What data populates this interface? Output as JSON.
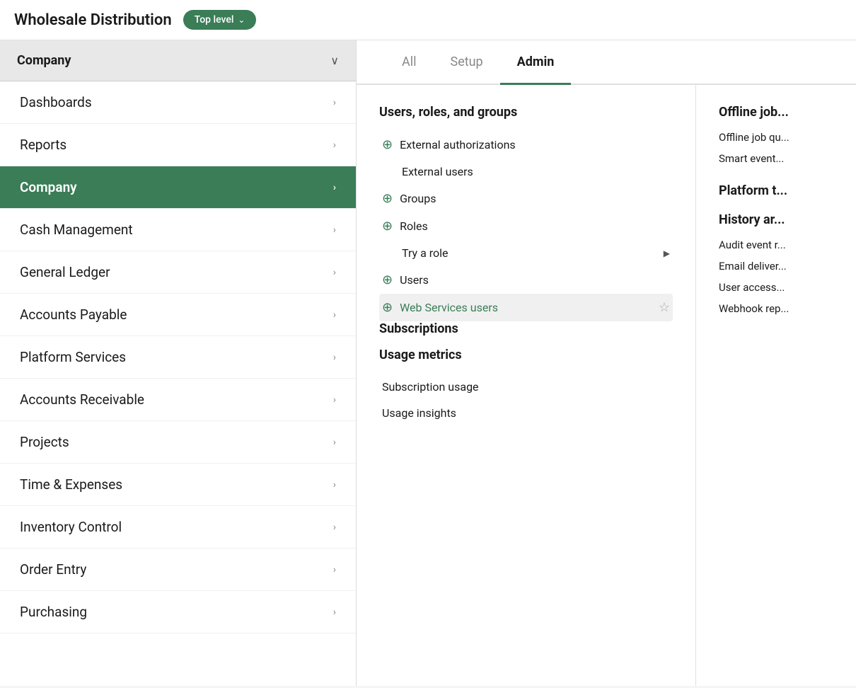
{
  "header": {
    "title": "Wholesale Distribution",
    "badge_label": "Top level",
    "badge_chevron": "⌄"
  },
  "sidebar": {
    "header_label": "Company",
    "header_chevron": "∨",
    "items": [
      {
        "id": "dashboards",
        "label": "Dashboards",
        "active": false
      },
      {
        "id": "reports",
        "label": "Reports",
        "active": false
      },
      {
        "id": "company",
        "label": "Company",
        "active": true
      },
      {
        "id": "cash-management",
        "label": "Cash Management",
        "active": false
      },
      {
        "id": "general-ledger",
        "label": "General Ledger",
        "active": false
      },
      {
        "id": "accounts-payable",
        "label": "Accounts Payable",
        "active": false
      },
      {
        "id": "platform-services",
        "label": "Platform Services",
        "active": false
      },
      {
        "id": "accounts-receivable",
        "label": "Accounts Receivable",
        "active": false
      },
      {
        "id": "projects",
        "label": "Projects",
        "active": false
      },
      {
        "id": "time-expenses",
        "label": "Time & Expenses",
        "active": false
      },
      {
        "id": "inventory-control",
        "label": "Inventory Control",
        "active": false
      },
      {
        "id": "order-entry",
        "label": "Order Entry",
        "active": false
      },
      {
        "id": "purchasing",
        "label": "Purchasing",
        "active": false
      }
    ]
  },
  "tabs": [
    {
      "id": "all",
      "label": "All",
      "active": false
    },
    {
      "id": "setup",
      "label": "Setup",
      "active": false
    },
    {
      "id": "admin",
      "label": "Admin",
      "active": true
    }
  ],
  "menu": {
    "sections": [
      {
        "id": "users-roles-groups",
        "title": "Users, roles, and groups",
        "items": [
          {
            "id": "external-auth",
            "label": "External authorizations",
            "has_plus": true,
            "highlighted": false,
            "green": false,
            "has_arrow": false,
            "has_star": false,
            "indented": false
          },
          {
            "id": "external-users",
            "label": "External users",
            "has_plus": false,
            "highlighted": false,
            "green": false,
            "has_arrow": false,
            "has_star": false,
            "indented": true
          },
          {
            "id": "groups",
            "label": "Groups",
            "has_plus": true,
            "highlighted": false,
            "green": false,
            "has_arrow": false,
            "has_star": false,
            "indented": false
          },
          {
            "id": "roles",
            "label": "Roles",
            "has_plus": true,
            "highlighted": false,
            "green": false,
            "has_arrow": false,
            "has_star": false,
            "indented": false
          },
          {
            "id": "try-a-role",
            "label": "Try a role",
            "has_plus": false,
            "highlighted": false,
            "green": false,
            "has_arrow": true,
            "has_star": false,
            "indented": true
          },
          {
            "id": "users",
            "label": "Users",
            "has_plus": true,
            "highlighted": false,
            "green": false,
            "has_arrow": false,
            "has_star": false,
            "indented": false
          },
          {
            "id": "web-services-users",
            "label": "Web Services users",
            "has_plus": true,
            "highlighted": true,
            "green": true,
            "has_arrow": false,
            "has_star": true,
            "indented": false
          }
        ]
      },
      {
        "id": "subscriptions",
        "title": "Subscriptions",
        "items": []
      },
      {
        "id": "usage-metrics",
        "title": "Usage metrics",
        "items": [
          {
            "id": "subscription-usage",
            "label": "Subscription usage",
            "has_plus": false,
            "highlighted": false,
            "green": false,
            "has_arrow": false,
            "has_star": false,
            "indented": false
          },
          {
            "id": "usage-insights",
            "label": "Usage insights",
            "has_plus": false,
            "highlighted": false,
            "green": false,
            "has_arrow": false,
            "has_star": false,
            "indented": false
          }
        ]
      }
    ]
  },
  "secondary": {
    "sections": [
      {
        "id": "offline-jobs",
        "title": "Offline job...",
        "items": [
          {
            "id": "offline-job-q",
            "label": "Offline job qu..."
          },
          {
            "id": "smart-event",
            "label": "Smart event..."
          }
        ]
      },
      {
        "id": "platform-tools",
        "title": "Platform t...",
        "items": []
      },
      {
        "id": "history-and-audit",
        "title": "History ar...",
        "items": [
          {
            "id": "audit-event",
            "label": "Audit event r..."
          },
          {
            "id": "email-delivery",
            "label": "Email deliver..."
          },
          {
            "id": "user-access",
            "label": "User access..."
          },
          {
            "id": "webhook-rep",
            "label": "Webhook rep..."
          }
        ]
      }
    ]
  }
}
